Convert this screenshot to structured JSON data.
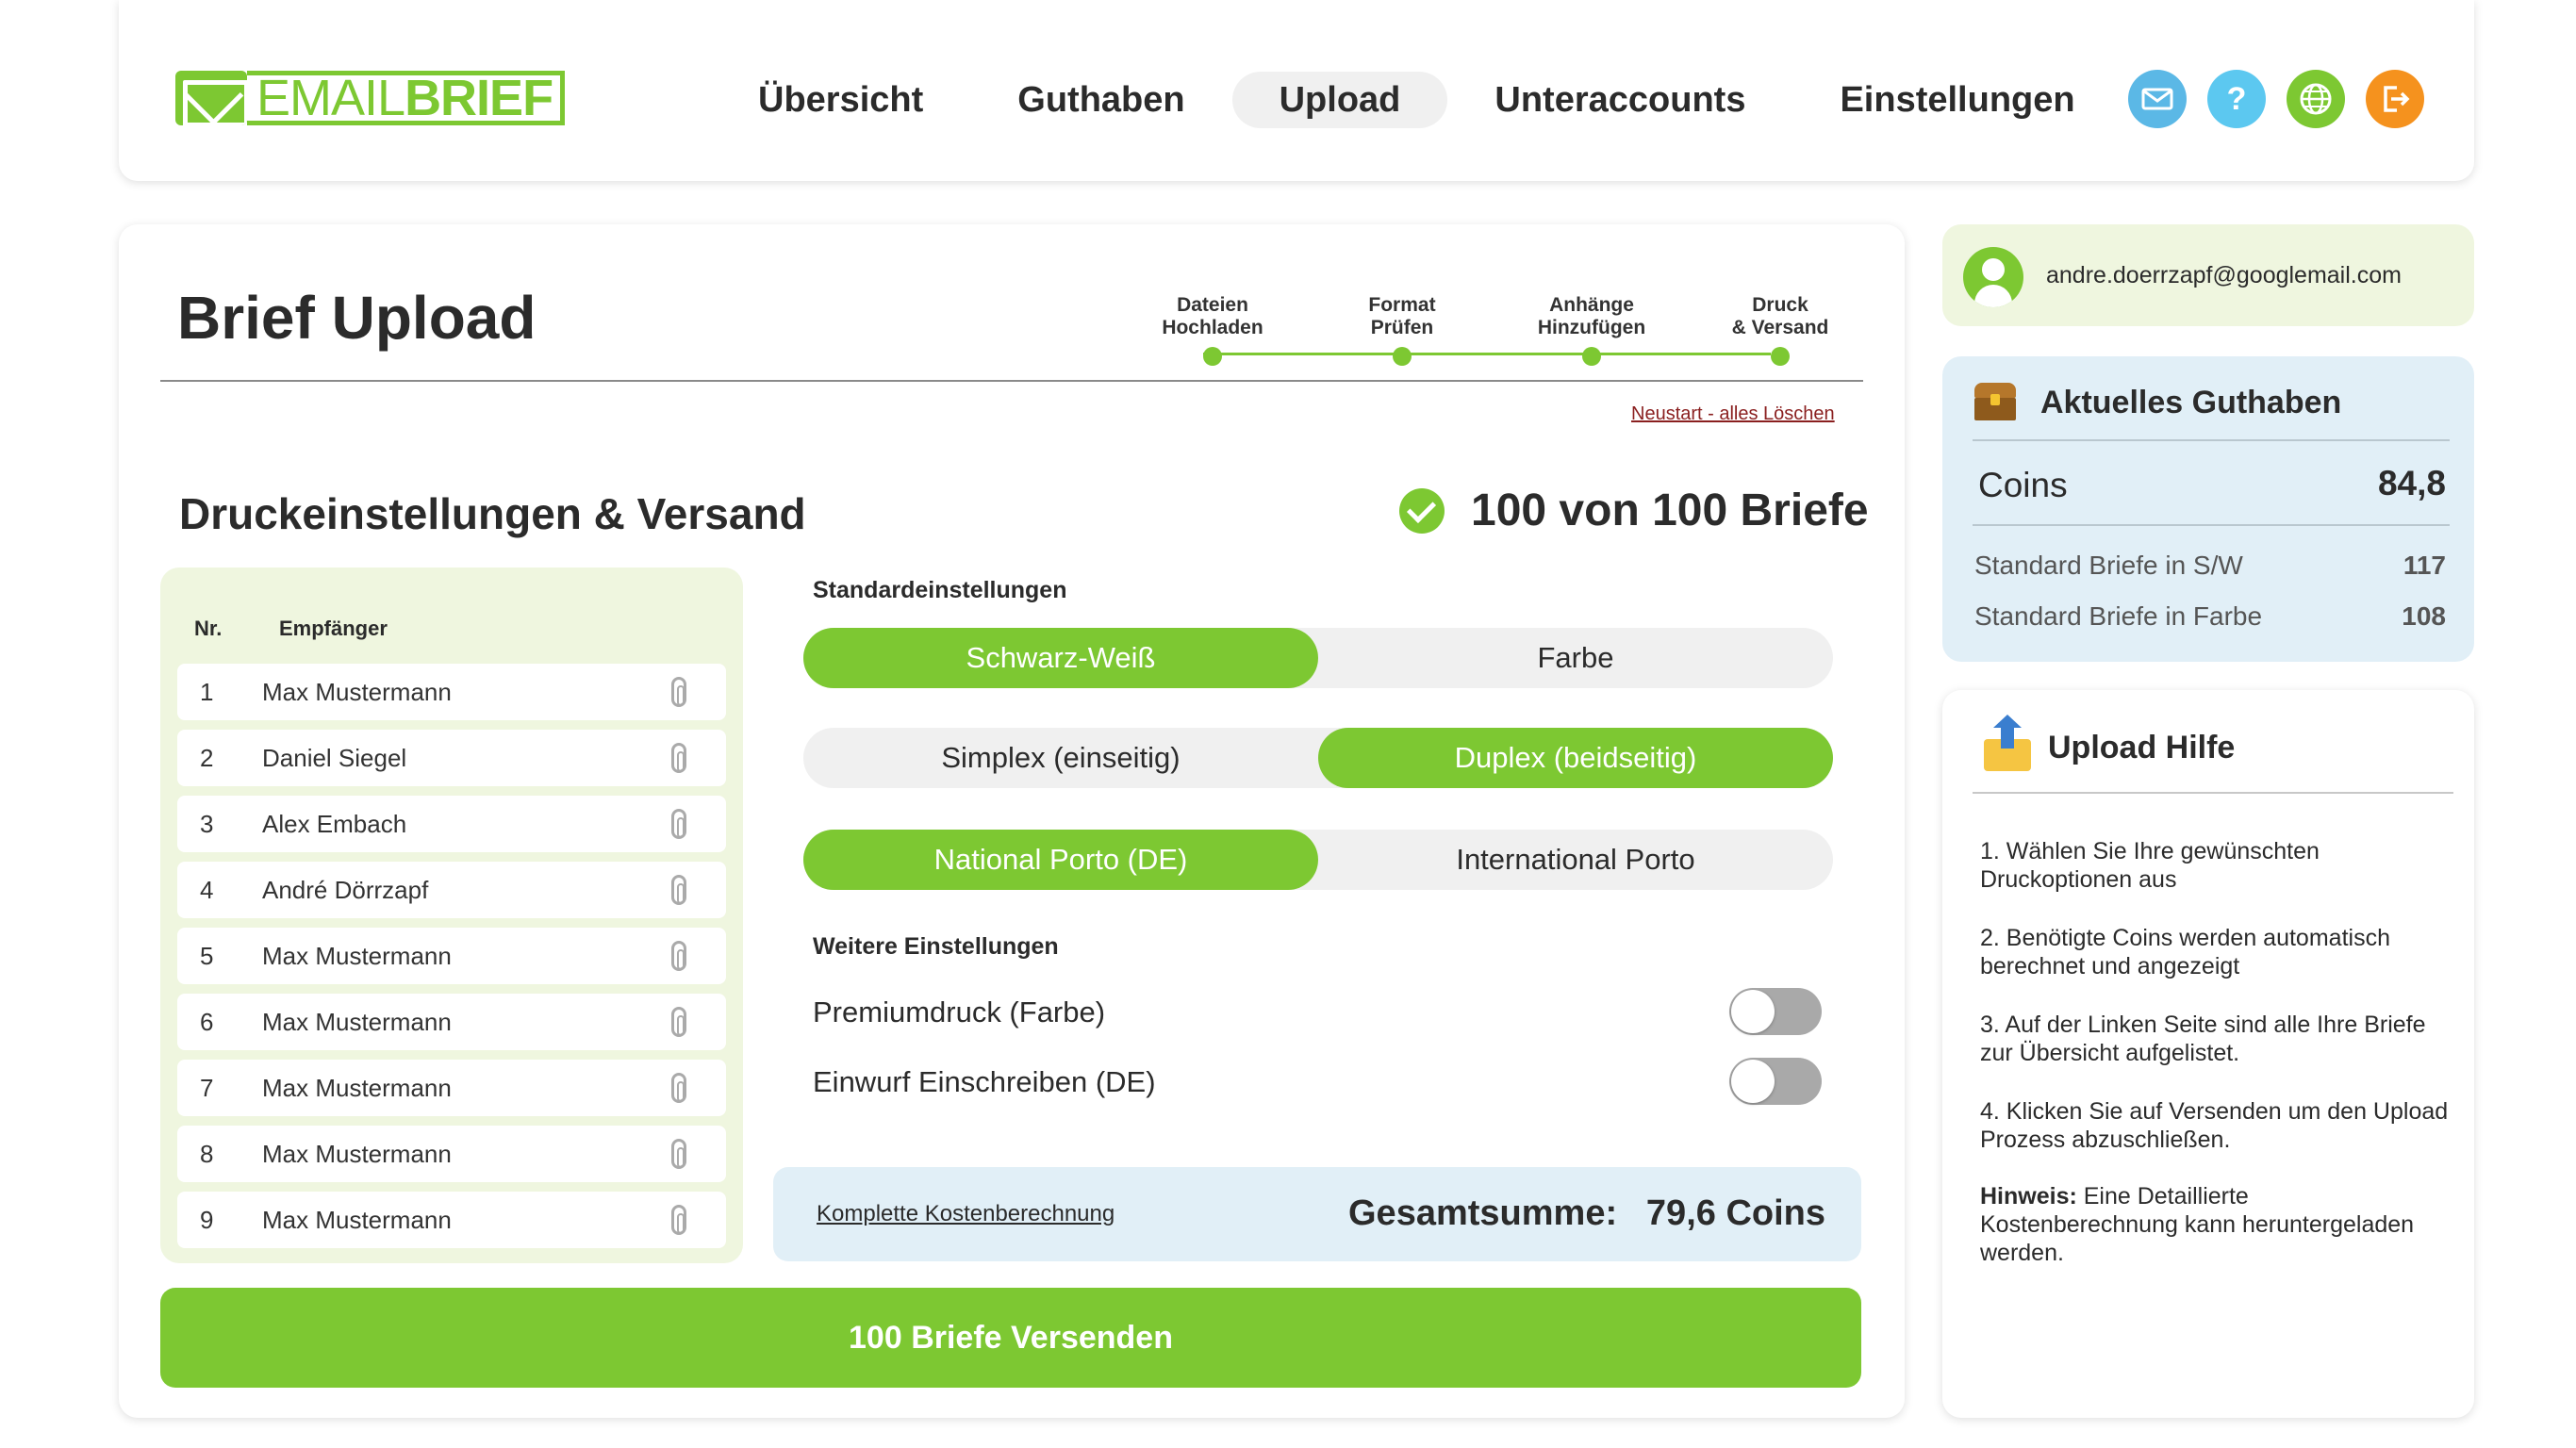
{
  "brand": {
    "logo_light": "EMAIL",
    "logo_bold": "BRIEF",
    "color": "#7dc832"
  },
  "nav": {
    "items": [
      {
        "label": "Übersicht",
        "active": false
      },
      {
        "label": "Guthaben",
        "active": false
      },
      {
        "label": "Upload",
        "active": true
      },
      {
        "label": "Unteraccounts",
        "active": false
      },
      {
        "label": "Einstellungen",
        "active": false
      }
    ]
  },
  "header_icons": [
    {
      "name": "mail-icon",
      "color": "#5bb8e6"
    },
    {
      "name": "help-icon",
      "color": "#5cc8f0",
      "glyph": "?"
    },
    {
      "name": "globe-icon",
      "color": "#7dc832"
    },
    {
      "name": "logout-icon",
      "color": "#f5921e"
    }
  ],
  "main": {
    "title": "Brief Upload",
    "steps": [
      {
        "line1": "Dateien",
        "line2": "Hochladen"
      },
      {
        "line1": "Format",
        "line2": "Prüfen"
      },
      {
        "line1": "Anhänge",
        "line2": "Hinzufügen"
      },
      {
        "line1": "Druck",
        "line2": "& Versand"
      }
    ],
    "reset_link": "Neustart - alles Löschen",
    "section_title": "Druckeinstellungen & Versand",
    "letter_count": "100 von 100 Briefe"
  },
  "recipients": {
    "col_nr": "Nr.",
    "col_name": "Empfänger",
    "rows": [
      {
        "nr": "1",
        "name": "Max Mustermann"
      },
      {
        "nr": "2",
        "name": "Daniel Siegel"
      },
      {
        "nr": "3",
        "name": "Alex Embach"
      },
      {
        "nr": "4",
        "name": "André Dörrzapf"
      },
      {
        "nr": "5",
        "name": "Max Mustermann"
      },
      {
        "nr": "6",
        "name": "Max Mustermann"
      },
      {
        "nr": "7",
        "name": "Max Mustermann"
      },
      {
        "nr": "8",
        "name": "Max Mustermann"
      },
      {
        "nr": "9",
        "name": "Max Mustermann"
      }
    ]
  },
  "settings": {
    "standard_label": "Standardeinstellungen",
    "color_mode": {
      "options": [
        "Schwarz-Weiß",
        "Farbe"
      ],
      "selected": 0
    },
    "duplex_mode": {
      "options": [
        "Simplex (einseitig)",
        "Duplex (beidseitig)"
      ],
      "selected": 1
    },
    "postage": {
      "options": [
        "National Porto (DE)",
        "International Porto"
      ],
      "selected": 0
    },
    "further_label": "Weitere Einstellungen",
    "toggles": [
      {
        "label": "Premiumdruck (Farbe)",
        "on": false
      },
      {
        "label": "Einwurf Einschreiben (DE)",
        "on": false
      }
    ]
  },
  "cost": {
    "link": "Komplette Kostenberechnung",
    "label": "Gesamtsumme:",
    "value": "79,6 Coins"
  },
  "send_button": "100 Briefe Versenden",
  "user": {
    "email": "andre.doerrzapf@googlemail.com"
  },
  "balance": {
    "title": "Aktuelles Guthaben",
    "coins_label": "Coins",
    "coins_value": "84,8",
    "rows": [
      {
        "label": "Standard Briefe in S/W",
        "value": "117"
      },
      {
        "label": "Standard Briefe in Farbe",
        "value": "108"
      }
    ]
  },
  "help": {
    "title": "Upload Hilfe",
    "items": [
      "1. Wählen Sie Ihre gewünschten Druckoptionen aus",
      "2.  Benötigte Coins werden automatisch berechnet und angezeigt",
      "3. Auf der Linken Seite sind alle Ihre Briefe zur Übersicht aufgelistet.",
      "4. Klicken Sie auf Versenden um den Upload Prozess abzuschließen."
    ],
    "hint_label": "Hinweis:",
    "hint_text": " Eine Detaillierte Kostenberechnung kann heruntergeladen werden."
  }
}
